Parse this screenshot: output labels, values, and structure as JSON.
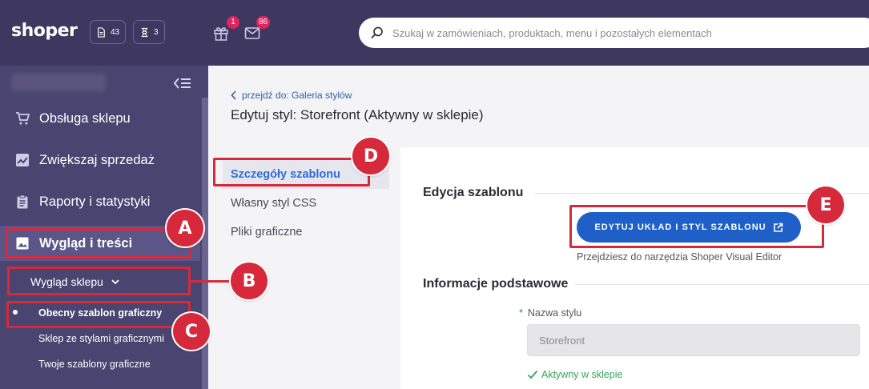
{
  "topbar": {
    "logo": "shoper",
    "chip_docs": {
      "icon": "document-icon",
      "count": "43"
    },
    "chip_tasks": {
      "icon": "hourglass-icon",
      "count": "3"
    },
    "gift": {
      "icon": "gift-icon",
      "badge": "1"
    },
    "mail": {
      "icon": "mail-icon",
      "badge": "86"
    },
    "search": {
      "placeholder": "Szukaj w zamówieniach, produktach, menu i pozostałych elementach"
    }
  },
  "sidebar": {
    "items": [
      {
        "label": "Obsługa sklepu",
        "icon": "cart-icon"
      },
      {
        "label": "Zwiększaj sprzedaż",
        "icon": "chart-icon"
      },
      {
        "label": "Raporty i statystyki",
        "icon": "clipboard-icon"
      },
      {
        "label": "Wygląd i treści",
        "icon": "image-icon",
        "active": true
      }
    ],
    "submenu": {
      "label": "Wygląd sklepu"
    },
    "subitems": [
      {
        "label": "Obecny szablon graficzny",
        "active": true
      },
      {
        "label": "Sklep ze stylami graficznymi"
      },
      {
        "label": "Twoje szablony graficzne"
      }
    ]
  },
  "page": {
    "back_link": "przejdź do: Galeria stylów",
    "title": "Edytuj styl: Storefront (Aktywny w sklepie)"
  },
  "tabs": [
    {
      "label": "Szczegóły szablonu",
      "active": true
    },
    {
      "label": "Własny styl CSS"
    },
    {
      "label": "Pliki graficzne"
    }
  ],
  "panel": {
    "section_edit": "Edycja szablonu",
    "edit_button": "EDYTUJ UKŁAD I STYL SZABLONU",
    "edit_hint": "Przejdziesz do narzędzia Shoper Visual Editor",
    "section_info": "Informacje podstawowe",
    "style_name_label": "Nazwa stylu",
    "style_name_required": "*",
    "style_name_value": "Storefront",
    "status": "Aktywny w sklepie"
  },
  "annotations": {
    "a": "A",
    "b": "B",
    "c": "C",
    "d": "D",
    "e": "E"
  },
  "colors": {
    "topbar": "#3e375f",
    "sidebar": "#4a4470",
    "accent": "#1e5fc8",
    "annotation": "#d62a3c",
    "success": "#3aa25c"
  }
}
